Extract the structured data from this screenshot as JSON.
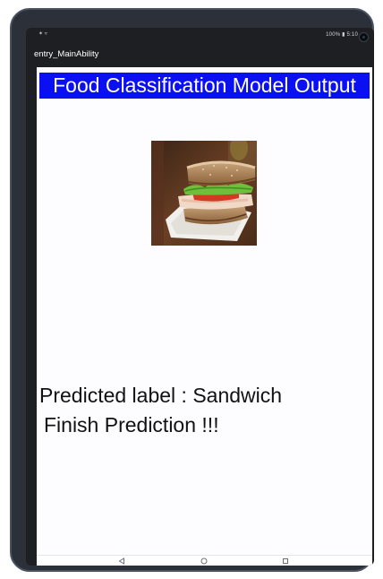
{
  "status_bar": {
    "left_icons": "✶ ▿",
    "right_text": "100% ▮ 5:10"
  },
  "app_bar": {
    "title": "entry_MainAbility"
  },
  "main": {
    "banner_title": "Food Classification Model Output",
    "image_subject": "sandwich",
    "prediction": "Predicted label : Sandwich",
    "status": "Finish Prediction !!!"
  },
  "nav_bar": {
    "back_icon": "back-triangle-icon",
    "home_icon": "home-circle-icon",
    "recents_icon": "recents-square-icon"
  },
  "colors": {
    "banner_bg": "#0a10f2",
    "banner_text": "#ffffff",
    "body_text": "#111111",
    "device_frame": "#2c3038"
  }
}
